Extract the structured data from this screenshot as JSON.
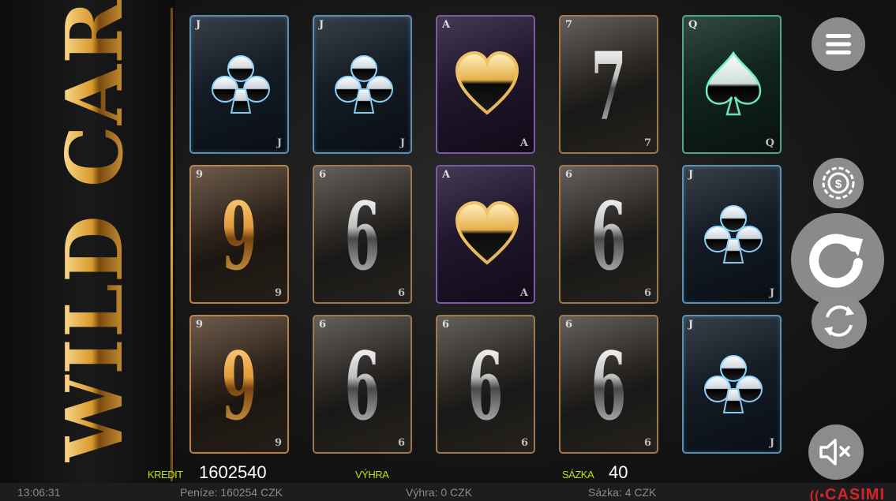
{
  "game": {
    "title": "WILD CARD"
  },
  "reels": [
    [
      {
        "rank": "J",
        "kind": "suit",
        "suit": "club",
        "frame": "blue"
      },
      {
        "rank": "9",
        "kind": "number",
        "frame": "bronze",
        "tone": "gold"
      },
      {
        "rank": "9",
        "kind": "number",
        "frame": "bronze",
        "tone": "gold"
      }
    ],
    [
      {
        "rank": "J",
        "kind": "suit",
        "suit": "club",
        "frame": "blue"
      },
      {
        "rank": "6",
        "kind": "number",
        "frame": "silver",
        "tone": "steel"
      },
      {
        "rank": "6",
        "kind": "number",
        "frame": "silver",
        "tone": "steel"
      }
    ],
    [
      {
        "rank": "A",
        "kind": "suit",
        "suit": "heart",
        "frame": "purple"
      },
      {
        "rank": "A",
        "kind": "suit",
        "suit": "heart",
        "frame": "purple"
      },
      {
        "rank": "6",
        "kind": "number",
        "frame": "silver",
        "tone": "steel"
      }
    ],
    [
      {
        "rank": "7",
        "kind": "number",
        "frame": "silver",
        "tone": "steel"
      },
      {
        "rank": "6",
        "kind": "number",
        "frame": "silver",
        "tone": "steel"
      },
      {
        "rank": "6",
        "kind": "number",
        "frame": "silver",
        "tone": "steel"
      }
    ],
    [
      {
        "rank": "Q",
        "kind": "suit",
        "suit": "spade",
        "frame": "green"
      },
      {
        "rank": "J",
        "kind": "suit",
        "suit": "club",
        "frame": "blue"
      },
      {
        "rank": "J",
        "kind": "suit",
        "suit": "club",
        "frame": "blue"
      }
    ]
  ],
  "controls": {
    "menu_icon": "hamburger-menu-icon",
    "coin_icon": "dollar-coin-icon",
    "spin_icon": "spin-arrow-icon",
    "autoplay_icon": "autoplay-arrows-icon",
    "sound_icon": "speaker-muted-icon"
  },
  "info_bar": {
    "credit_label": "KREDIT",
    "credit_value": "1602540",
    "win_label": "VÝHRA",
    "win_value": "",
    "bet_label": "SÁZKA",
    "bet_value": "40"
  },
  "status_bar": {
    "time": "13:06:31",
    "money": "Peníze: 160254 CZK",
    "win": "Výhra: 0 CZK",
    "bet": "Sázka: 4 CZK",
    "brand": "CASIMI"
  },
  "colors": {
    "label_green": "#b8e400",
    "brand_red": "#d4242a",
    "gold": "#d99a35",
    "control_grey": "#8c8c8c"
  }
}
